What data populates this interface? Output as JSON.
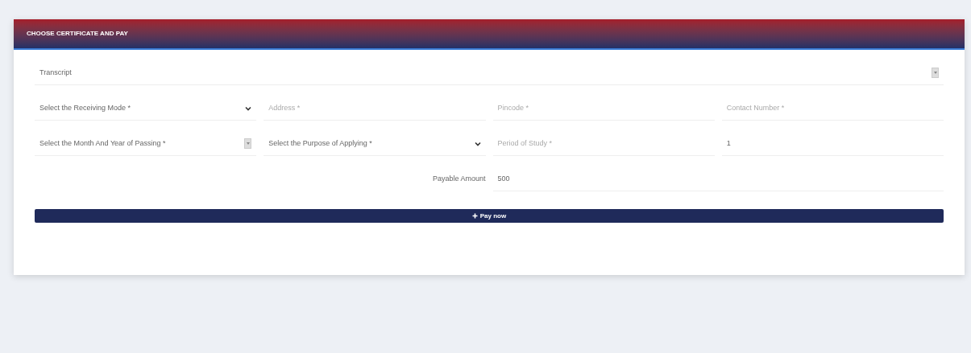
{
  "card": {
    "title": "CHOOSE CERTIFICATE AND PAY"
  },
  "rows": [
    {
      "fields": [
        {
          "kind": "select-box",
          "value": "Transcript"
        }
      ]
    },
    {
      "fields": [
        {
          "kind": "select-chevron",
          "value": "Select the Receiving Mode *"
        },
        {
          "kind": "input",
          "placeholder": "Address *"
        },
        {
          "kind": "input",
          "placeholder": "Pincode *"
        },
        {
          "kind": "input",
          "placeholder": "Contact Number *"
        }
      ]
    },
    {
      "fields": [
        {
          "kind": "select-box",
          "value": "Select the Month And Year of Passing *"
        },
        {
          "kind": "select-chevron",
          "value": "Select the Purpose of Applying *"
        },
        {
          "kind": "input",
          "placeholder": "Period of Study *"
        },
        {
          "kind": "input",
          "value": "1"
        }
      ]
    },
    {
      "label": "Payable Amount",
      "fields": [
        {
          "kind": "input",
          "value": "500"
        }
      ]
    }
  ],
  "pay_button": {
    "label": "Pay now"
  }
}
